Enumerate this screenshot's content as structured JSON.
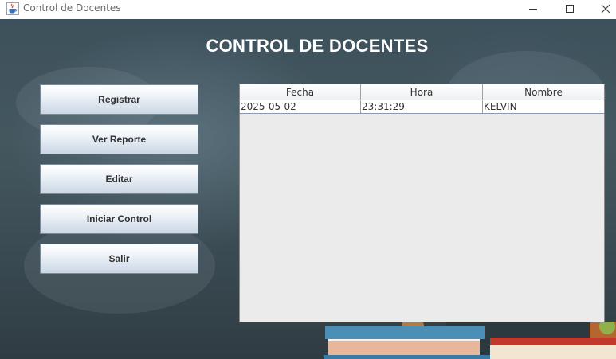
{
  "window": {
    "title": "Control de Docentes"
  },
  "header": {
    "title": "CONTROL DE DOCENTES"
  },
  "buttons": [
    {
      "label": "Registrar"
    },
    {
      "label": "Ver Reporte"
    },
    {
      "label": "Editar"
    },
    {
      "label": "Iniciar Control"
    },
    {
      "label": "Salir"
    }
  ],
  "table": {
    "columns": [
      "Fecha",
      "Hora",
      "Nombre"
    ],
    "rows": [
      [
        "2025-05-02",
        "23:31:29",
        "KELVIN"
      ]
    ]
  },
  "icons": {
    "app": "java-cup-icon",
    "minimize": "minimize-icon",
    "maximize": "maximize-icon",
    "close": "close-icon"
  },
  "colors": {
    "background": "#3d515c",
    "heading": "#ffffff",
    "button_top": "#ffffff",
    "button_bottom": "#cbd7e4",
    "table_bg": "#ebebeb"
  }
}
